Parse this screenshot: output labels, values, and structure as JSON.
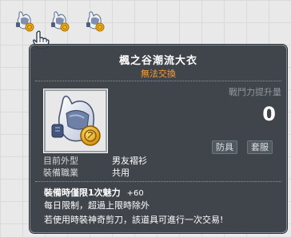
{
  "inventory": {
    "slots": [
      {
        "icon": "bunny-hoodie-coin-icon"
      },
      {
        "icon": "bunny-hoodie-coin-icon"
      },
      {
        "icon": "bunny-hoodie-coin-icon"
      }
    ],
    "cursor": "hand-pointer-icon"
  },
  "tooltip": {
    "title": "楓之谷潮流大衣",
    "subtitle": "無法交換",
    "power_label": "戰鬥力提升量",
    "power_value": "0",
    "tags": [
      "防具",
      "套服"
    ],
    "info": [
      {
        "label": "目前外型",
        "value": "男友褶衫"
      },
      {
        "label": "裝備職業",
        "value": "共用"
      }
    ],
    "bonus_label": "裝備時僅限1次魅力",
    "bonus_value": "+60",
    "notes": [
      "每日限制，超過上限時除外",
      "若使用時裝神奇剪刀，該道具可進行一次交易!"
    ]
  },
  "colors": {
    "tooltip_bg": "#373c43",
    "subtitle": "#ff9a2e",
    "power_label": "#8e969c"
  }
}
